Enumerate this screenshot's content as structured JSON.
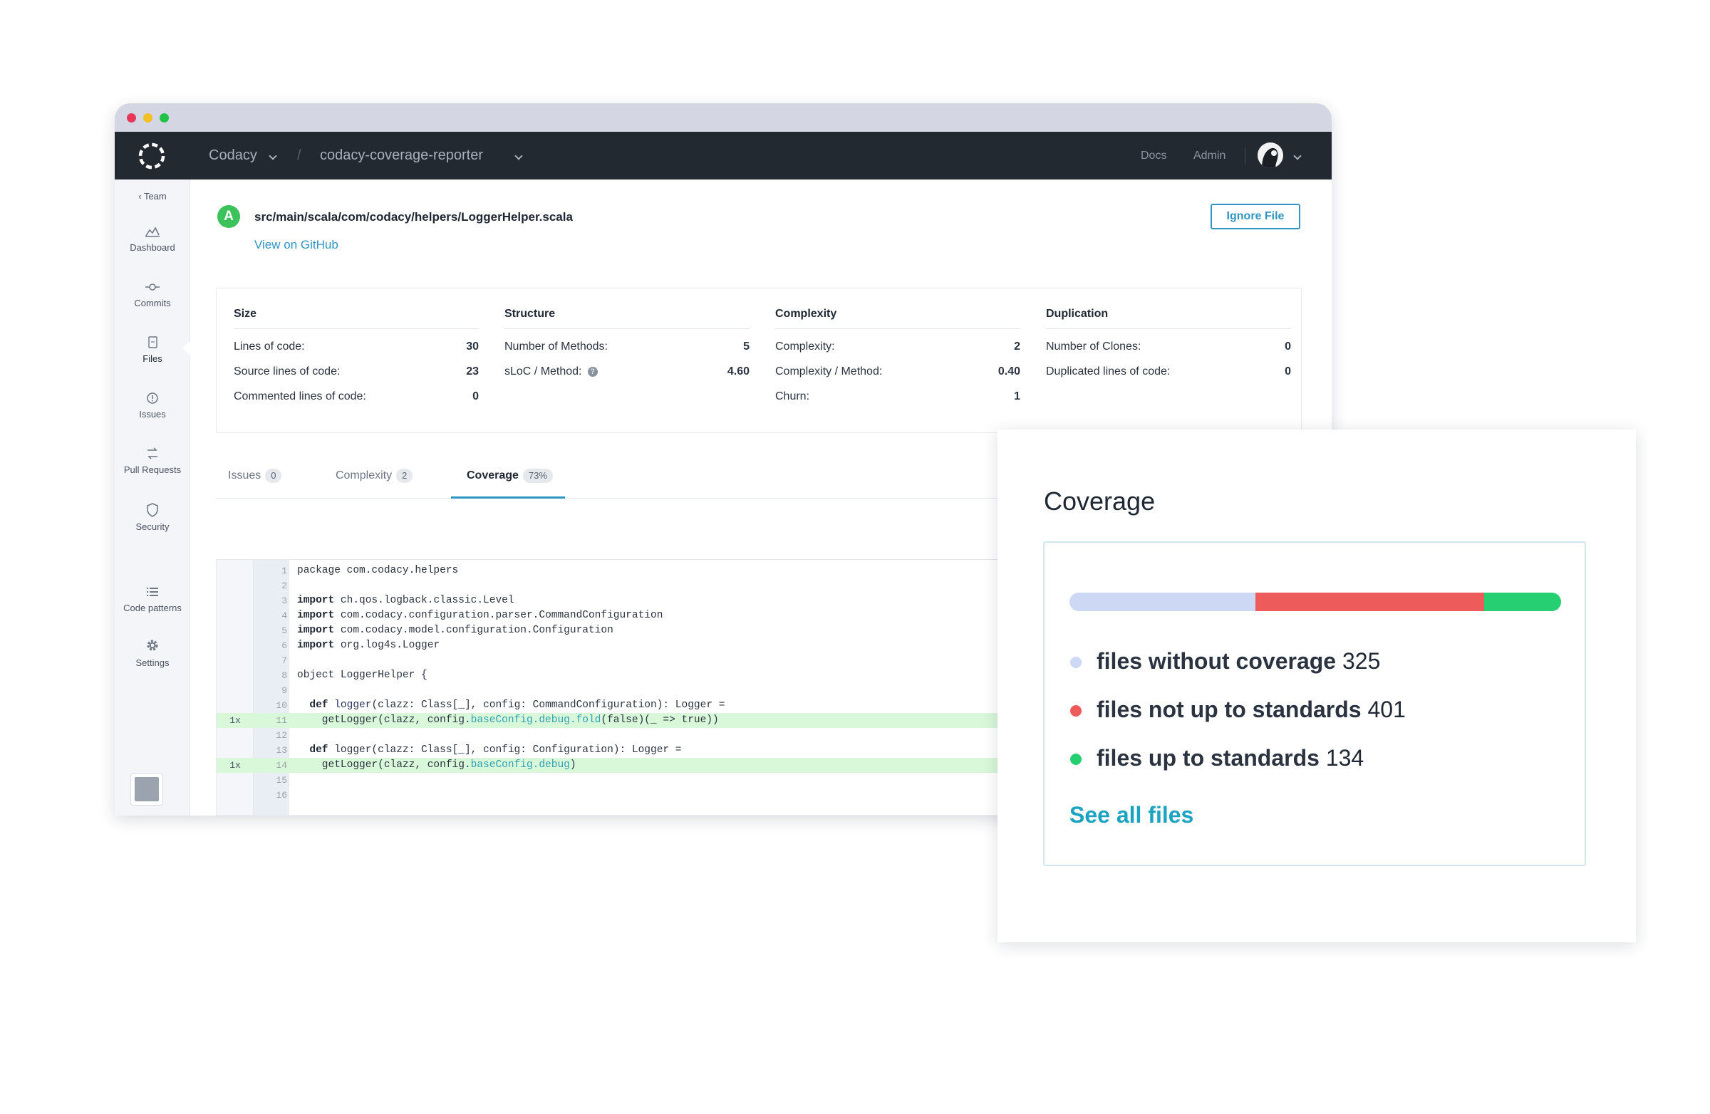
{
  "topnav": {
    "org": "Codacy",
    "repo": "codacy-coverage-reporter",
    "links": [
      "Docs",
      "Admin"
    ]
  },
  "sidebar": {
    "back": "Team",
    "items": [
      {
        "label": "Dashboard",
        "icon": "dashboard-chart-icon"
      },
      {
        "label": "Commits",
        "icon": "commit-icon"
      },
      {
        "label": "Files",
        "icon": "file-icon"
      },
      {
        "label": "Issues",
        "icon": "issue-circle-icon"
      },
      {
        "label": "Pull Requests",
        "icon": "pull-request-icon"
      },
      {
        "label": "Security",
        "icon": "shield-icon"
      },
      {
        "label": "Code patterns",
        "icon": "list-icon"
      },
      {
        "label": "Settings",
        "icon": "gear-icon"
      }
    ]
  },
  "file": {
    "grade": "A",
    "path": "src/main/scala/com/codacy/helpers/LoggerHelper.scala",
    "github_link": "View on GitHub",
    "ignore_button": "Ignore File"
  },
  "metrics": [
    {
      "title": "Size",
      "rows": [
        {
          "label": "Lines of code:",
          "value": "30"
        },
        {
          "label": "Source lines of code:",
          "value": "23"
        },
        {
          "label": "Commented lines of code:",
          "value": "0"
        }
      ]
    },
    {
      "title": "Structure",
      "rows": [
        {
          "label": "Number of Methods:",
          "value": "5"
        },
        {
          "label": "sLoC / Method:",
          "value": "4.60",
          "help": "?"
        }
      ]
    },
    {
      "title": "Complexity",
      "rows": [
        {
          "label": "Complexity:",
          "value": "2"
        },
        {
          "label": "Complexity / Method:",
          "value": "0.40"
        },
        {
          "label": "Churn:",
          "value": "1"
        }
      ]
    },
    {
      "title": "Duplication",
      "rows": [
        {
          "label": "Number of Clones:",
          "value": "0"
        },
        {
          "label": "Duplicated lines of code:",
          "value": "0"
        }
      ]
    }
  ],
  "tabs": [
    {
      "label": "Issues",
      "count": "0"
    },
    {
      "label": "Complexity",
      "count": "2"
    },
    {
      "label": "Coverage",
      "count": "73%",
      "active": true
    }
  ],
  "code": [
    {
      "n": "1",
      "hits": "",
      "parts": [
        [
          "",
          "package com.codacy.helpers"
        ]
      ]
    },
    {
      "n": "2",
      "hits": "",
      "parts": [
        [
          "",
          ""
        ]
      ]
    },
    {
      "n": "3",
      "hits": "",
      "parts": [
        [
          "kw",
          "import"
        ],
        [
          "",
          " ch.qos.logback.classic.Level"
        ]
      ]
    },
    {
      "n": "4",
      "hits": "",
      "parts": [
        [
          "kw",
          "import"
        ],
        [
          "",
          " com.codacy.configuration.parser.CommandConfiguration"
        ]
      ]
    },
    {
      "n": "5",
      "hits": "",
      "parts": [
        [
          "kw",
          "import"
        ],
        [
          "",
          " com.codacy.model.configuration.Configuration"
        ]
      ]
    },
    {
      "n": "6",
      "hits": "",
      "parts": [
        [
          "kw",
          "import"
        ],
        [
          "",
          " org.log4s.Logger"
        ]
      ]
    },
    {
      "n": "7",
      "hits": "",
      "parts": [
        [
          "",
          ""
        ]
      ]
    },
    {
      "n": "8",
      "hits": "",
      "parts": [
        [
          "",
          "object LoggerHelper {"
        ]
      ]
    },
    {
      "n": "9",
      "hits": "",
      "parts": [
        [
          "",
          ""
        ]
      ]
    },
    {
      "n": "10",
      "hits": "",
      "parts": [
        [
          "",
          "  "
        ],
        [
          "kw",
          "def"
        ],
        [
          "fn",
          " logger"
        ],
        [
          "",
          "(clazz: Class[_], config: CommandConfiguration): Logger ="
        ]
      ]
    },
    {
      "n": "11",
      "hits": "1x",
      "covered": true,
      "parts": [
        [
          "",
          "    getLogger(clazz, config."
        ],
        [
          "prop",
          "baseConfig.debug.fold"
        ],
        [
          "",
          "(false)(_ => true))"
        ]
      ]
    },
    {
      "n": "12",
      "hits": "",
      "parts": [
        [
          "",
          ""
        ]
      ]
    },
    {
      "n": "13",
      "hits": "",
      "parts": [
        [
          "",
          "  "
        ],
        [
          "kw",
          "def"
        ],
        [
          "",
          " logger(clazz: Class[_], config: Configuration): Logger ="
        ]
      ]
    },
    {
      "n": "14",
      "hits": "1x",
      "covered": true,
      "parts": [
        [
          "",
          "    getLogger(clazz, config."
        ],
        [
          "prop",
          "baseConfig.debug"
        ],
        [
          "",
          ")"
        ]
      ]
    },
    {
      "n": "15",
      "hits": "",
      "parts": [
        [
          "",
          ""
        ]
      ]
    },
    {
      "n": "16",
      "hits": "",
      "parts": [
        [
          "",
          ""
        ]
      ]
    }
  ],
  "coverage_card": {
    "title": "Coverage",
    "segments": [
      {
        "label": "files without coverage",
        "value": 325,
        "color": "#ccd8f4"
      },
      {
        "label": "files not up to standards",
        "value": 401,
        "color": "#ed5b5b"
      },
      {
        "label": "files up to standards",
        "value": 134,
        "color": "#26cf71"
      }
    ],
    "see_all": "See all files"
  },
  "colors": {
    "accent": "#2f95c4",
    "topnav": "#232931",
    "grade": "#3bc25a"
  }
}
